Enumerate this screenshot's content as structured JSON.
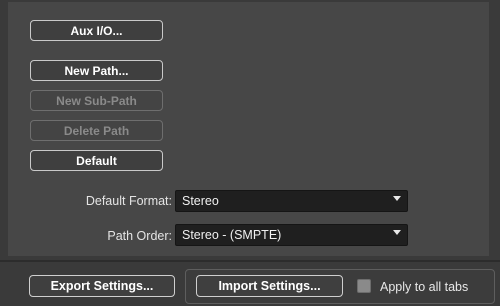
{
  "buttons": {
    "aux_io": "Aux I/O...",
    "new_path": "New Path...",
    "new_sub_path": "New Sub-Path",
    "delete_path": "Delete Path",
    "default": "Default"
  },
  "fields": {
    "default_format": {
      "label": "Default Format:",
      "value": "Stereo"
    },
    "path_order": {
      "label": "Path Order:",
      "value": "Stereo - (SMPTE)"
    }
  },
  "footer": {
    "export_settings": "Export Settings...",
    "import_settings": "Import Settings...",
    "apply_to_all_tabs": "Apply to all tabs",
    "apply_checked": false
  }
}
